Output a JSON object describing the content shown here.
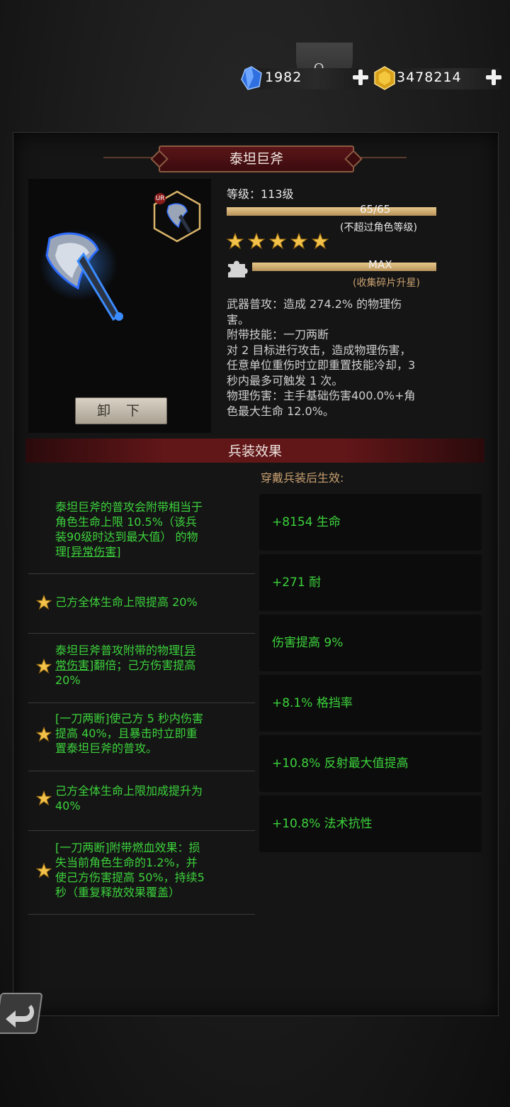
{
  "currency": {
    "gem": {
      "icon": "blue-crystal-icon",
      "value": "1982"
    },
    "gold": {
      "icon": "gold-crystal-icon",
      "value": "3478214"
    }
  },
  "item": {
    "name": "泰坦巨斧",
    "rarity_badge": "UR",
    "unequip_label": "卸 下",
    "level_label": "等级：113级",
    "level_progress": "65/65",
    "level_fraction": 1.0,
    "level_note": "(不超过角色等级)",
    "stars": 5,
    "fragment_progress": "MAX",
    "fragment_fraction": 1.0,
    "fragment_note": "(收集碎片升星)",
    "description": [
      "武器普攻：造成 274.2% 的物理伤\n害。",
      "附带技能：一刀两断",
      "对 2 目标进行攻击，造成物理伤害，\n任意单位重伤时立即重置技能冷却，3\n秒内最多可触发 1 次。",
      "物理伤害：主手基础伤害400.0%+角\n色最大生命 12.0%。"
    ]
  },
  "effects": {
    "title": "兵装效果",
    "subtitle": "穿戴兵装后生效:",
    "list": [
      {
        "star": false,
        "pre": "泰坦巨斧的普攻会附带相当于\n角色生命上限 10.5%（该兵\n装90级时达到最大值） 的物\n理[",
        "link": "异常伤害",
        "post": "]"
      },
      {
        "star": true,
        "pre": "己方全体生命上限提高 20%",
        "link": "",
        "post": ""
      },
      {
        "star": true,
        "pre": "泰坦巨斧普攻附带的物理[",
        "link": "异\n常伤害",
        "post": "]翻倍；己方伤害提高\n20%"
      },
      {
        "star": true,
        "pre": "[一刀两断]使己方 5 秒内伤害\n提高 40%，且暴击时立即重\n置泰坦巨斧的普攻。",
        "link": "",
        "post": ""
      },
      {
        "star": true,
        "pre": "己方全体生命上限加成提升为\n40%",
        "link": "",
        "post": ""
      },
      {
        "star": true,
        "pre": "[一刀两断]附带燃血效果：损\n失当前角色生命的1.2%，并\n使己方伤害提高 50%，持续5\n秒（重复释放效果覆盖）",
        "link": "",
        "post": ""
      }
    ],
    "stats": [
      "+8154 生命",
      "+271 耐",
      "伤害提高 9%",
      "+8.1% 格挡率",
      "+10.8% 反射最大值提高",
      "+10.8% 法术抗性"
    ]
  },
  "colors": {
    "effect_text": "#3cd23c",
    "accent_gold": "#c8a070",
    "title_red": "#611618"
  }
}
